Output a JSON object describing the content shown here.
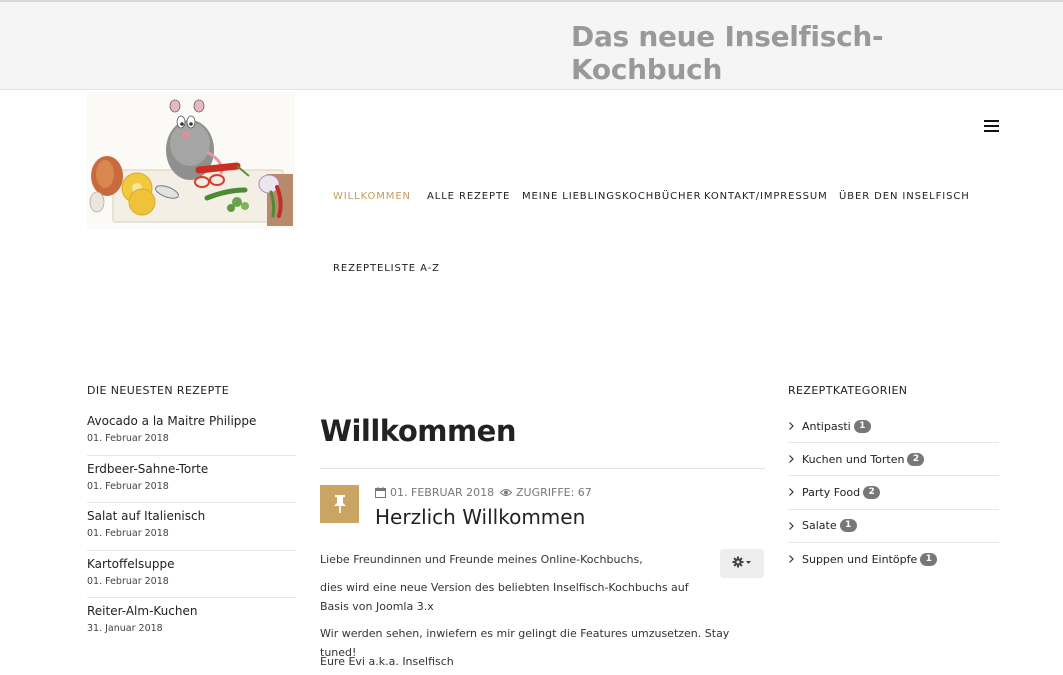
{
  "site": {
    "title_line1": "Das neue Inselfisch-",
    "title_line2": "Kochbuch"
  },
  "nav": {
    "items": [
      {
        "label": "Willkommen",
        "active": true
      },
      {
        "label": "Alle Rezepte"
      },
      {
        "label": "Meine Lieblingskochbücher"
      },
      {
        "label": "Kontakt/Impressum"
      },
      {
        "label": "Über den Inselfisch"
      },
      {
        "label": "Rezepteliste A-Z"
      }
    ],
    "accent_color": "#c39c5a"
  },
  "recent": {
    "heading": "Die neuesten Rezepte",
    "items": [
      {
        "title": "Avocado a la Maitre Philippe",
        "date": "01. Februar 2018"
      },
      {
        "title": "Erdbeer-Sahne-Torte",
        "date": "01. Februar 2018"
      },
      {
        "title": "Salat auf Italienisch",
        "date": "01. Februar 2018"
      },
      {
        "title": "Kartoffelsuppe",
        "date": "01. Februar 2018"
      },
      {
        "title": "Reiter-Alm-Kuchen",
        "date": "31. Januar 2018"
      }
    ]
  },
  "main": {
    "page_title": "Willkommen",
    "article": {
      "date": "01. FEBRUAR 2018",
      "hits": "ZUGRIFFE: 67",
      "title": "Herzlich Willkommen",
      "paragraphs": [
        "Liebe Freundinnen und Freunde meines Online-Kochbuchs,",
        "dies wird eine neue Version des beliebten Inselfisch-Kochbuchs auf Basis von Joomla 3.x",
        "Wir werden sehen, inwiefern es mir gelingt die Features umzusetzen. Stay tuned!",
        "Eure Evi a.k.a. Inselfisch"
      ],
      "pin_color": "#c9a463"
    }
  },
  "categories": {
    "heading": "Rezeptkategorien",
    "items": [
      {
        "label": "Antipasti",
        "count": "1"
      },
      {
        "label": "Kuchen und Torten",
        "count": "2"
      },
      {
        "label": "Party Food",
        "count": "2"
      },
      {
        "label": "Salate",
        "count": "1"
      },
      {
        "label": "Suppen und Eintöpfe",
        "count": "1"
      }
    ]
  },
  "icons": {
    "menu": "hamburger-icon",
    "pin": "pushpin-icon",
    "date": "calendar-icon",
    "hits": "eye-icon",
    "tools": "gear-icon",
    "chevron": "chevron-right-icon"
  }
}
